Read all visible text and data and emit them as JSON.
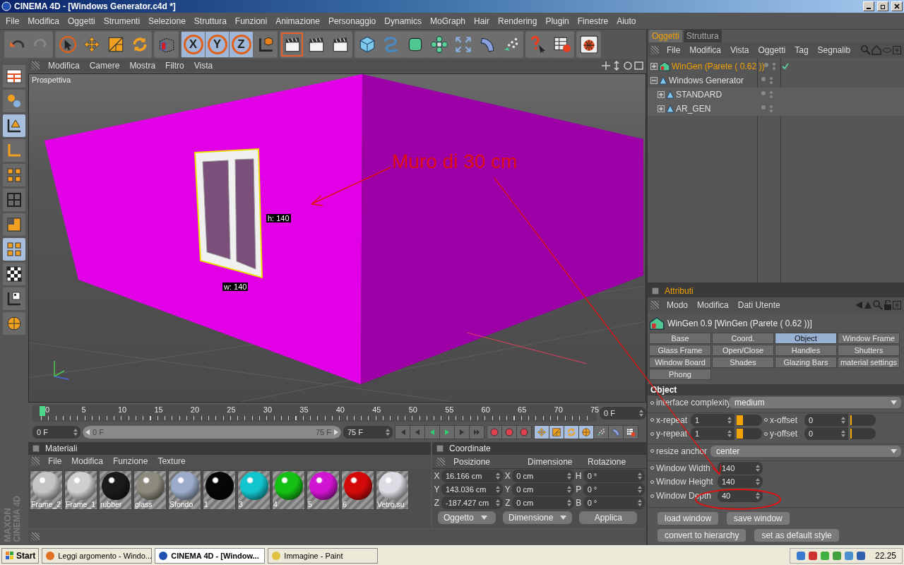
{
  "window": {
    "title": "CINEMA 4D - [Windows Generator.c4d *]"
  },
  "menu": [
    "File",
    "Modifica",
    "Oggetti",
    "Strumenti",
    "Selezione",
    "Struttura",
    "Funzioni",
    "Animazione",
    "Personaggio",
    "Dynamics",
    "MoGraph",
    "Hair",
    "Rendering",
    "Plugin",
    "Finestre",
    "Aiuto"
  ],
  "axis_buttons": [
    {
      "label": "X",
      "selected": true
    },
    {
      "label": "Y",
      "selected": true
    },
    {
      "label": "Z",
      "selected": true
    }
  ],
  "viewport": {
    "menu": [
      "Modifica",
      "Camere",
      "Mostra",
      "Filtro",
      "Vista"
    ],
    "camera": "Prospettiva",
    "annotation": "Muro di 30 cm",
    "height_label": "h: 140",
    "width_label": "w: 140"
  },
  "logo": [
    "MAXON",
    "CINEMA 4D"
  ],
  "timeline": {
    "ticks": [
      "0",
      "5",
      "10",
      "15",
      "20",
      "25",
      "30",
      "35",
      "40",
      "45",
      "50",
      "55",
      "60",
      "65",
      "70",
      "75"
    ],
    "level": 0,
    "current": "0 F",
    "start": "0 F",
    "range": {
      "start": "0 F",
      "end": "75 F",
      "level": 1
    },
    "end": "75 F"
  },
  "materials": {
    "title": "Materiali",
    "menu": [
      "File",
      "Modifica",
      "Funzione",
      "Texture"
    ],
    "items": [
      {
        "name": "Frame_2",
        "color": "#c4c4c4"
      },
      {
        "name": "Frame_1",
        "color": "#cfcfcf"
      },
      {
        "name": "rubber",
        "color": "#1a1a1a"
      },
      {
        "name": "glass",
        "color": "#8c8a7c"
      },
      {
        "name": "Sfondo",
        "color": "#9babc9"
      },
      {
        "name": "1",
        "color": "#060606"
      },
      {
        "name": "3",
        "color": "#12c4cc"
      },
      {
        "name": "4",
        "color": "#14c014"
      },
      {
        "name": "5",
        "color": "#d014d0"
      },
      {
        "name": "6",
        "color": "#d40a0a"
      },
      {
        "name": "Vetro.su",
        "color": "#dcdce4"
      }
    ]
  },
  "coordinates": {
    "title": "Coordinate",
    "columns": [
      "Posizione",
      "Dimensione",
      "Rotazione"
    ],
    "rows": [
      [
        {
          "axis": "X",
          "value": "16.166 cm"
        },
        {
          "axis": "X",
          "value": "0 cm"
        },
        {
          "axis": "H",
          "value": "0 °"
        }
      ],
      [
        {
          "axis": "Y",
          "value": "143.036 cm"
        },
        {
          "axis": "Y",
          "value": "0 cm"
        },
        {
          "axis": "P",
          "value": "0 °"
        }
      ],
      [
        {
          "axis": "Z",
          "value": "-187.427 cm"
        },
        {
          "axis": "Z",
          "value": "0 cm"
        },
        {
          "axis": "B",
          "value": "0 °"
        }
      ]
    ],
    "mode": "Oggetto",
    "size_mode": "Dimensione",
    "apply": "Applica"
  },
  "objects": {
    "tabs": [
      {
        "label": "Oggetti",
        "selected": true
      },
      {
        "label": "Struttura",
        "selected": false
      }
    ],
    "menu": [
      "File",
      "Modifica",
      "Vista",
      "Oggetti",
      "Tag",
      "Segnalib"
    ],
    "tree": [
      {
        "name": "WinGen (Parete ( 0.62 ))",
        "selected": true,
        "expanded": false,
        "enabled": true
      },
      {
        "name": "Windows Generator",
        "selected": false,
        "expanded": true,
        "enabled": false,
        "children": [
          {
            "name": "STANDARD",
            "selected": false,
            "expanded": false,
            "enabled": false
          },
          {
            "name": "AR_GEN",
            "selected": false,
            "expanded": false,
            "enabled": false
          }
        ]
      }
    ]
  },
  "attributes": {
    "title": "Attributi",
    "menu": [
      "Modo",
      "Modifica",
      "Dati Utente"
    ],
    "object_title": "WinGen 0.9 [WinGen (Parete ( 0.62 ))]",
    "tabs": [
      {
        "label": "Base",
        "selected": false
      },
      {
        "label": "Coord.",
        "selected": false
      },
      {
        "label": "Object",
        "selected": true
      },
      {
        "label": "Window Frame",
        "selected": false
      },
      {
        "label": "Glass Frame",
        "selected": false
      },
      {
        "label": "Open/Close",
        "selected": false
      },
      {
        "label": "Handles",
        "selected": false
      },
      {
        "label": "Shutters",
        "selected": false
      },
      {
        "label": "Window Board",
        "selected": false
      },
      {
        "label": "Shades",
        "selected": false
      },
      {
        "label": "Glazing Bars",
        "selected": false
      },
      {
        "label": "material settings",
        "selected": false
      },
      {
        "label": "Phong",
        "selected": false
      }
    ],
    "section": "Object",
    "fields": [
      {
        "kind": "dropdown",
        "label": "interface complexity",
        "value": "medium"
      },
      {
        "kind": "sliders",
        "items": [
          {
            "label": "x-repeat",
            "value": "1",
            "level": 0.27
          },
          {
            "label": "x-offset",
            "value": "0",
            "level": 0
          }
        ]
      },
      {
        "kind": "sliders",
        "items": [
          {
            "label": "y-repeat",
            "value": "1",
            "level": 0.27
          },
          {
            "label": "y-offset",
            "value": "0",
            "level": 0
          }
        ]
      },
      {
        "kind": "dropdown",
        "label": "resize anchor",
        "value": "center"
      },
      {
        "kind": "number",
        "label": "Window Width",
        "value": "140"
      },
      {
        "kind": "number",
        "label": "Window Height",
        "value": "140"
      },
      {
        "kind": "number",
        "label": "Window Depth",
        "value": "40"
      }
    ],
    "buttons": [
      [
        "load window",
        "save window"
      ],
      [
        "convert to hierarchy",
        "set as default style"
      ]
    ]
  },
  "taskbar": {
    "start": "Start",
    "tasks": [
      {
        "label": "Leggi argomento - Windo...",
        "selected": false
      },
      {
        "label": "CINEMA 4D - [Window...",
        "selected": true
      },
      {
        "label": "Immagine - Paint",
        "selected": false
      }
    ],
    "clock": "22.25"
  }
}
